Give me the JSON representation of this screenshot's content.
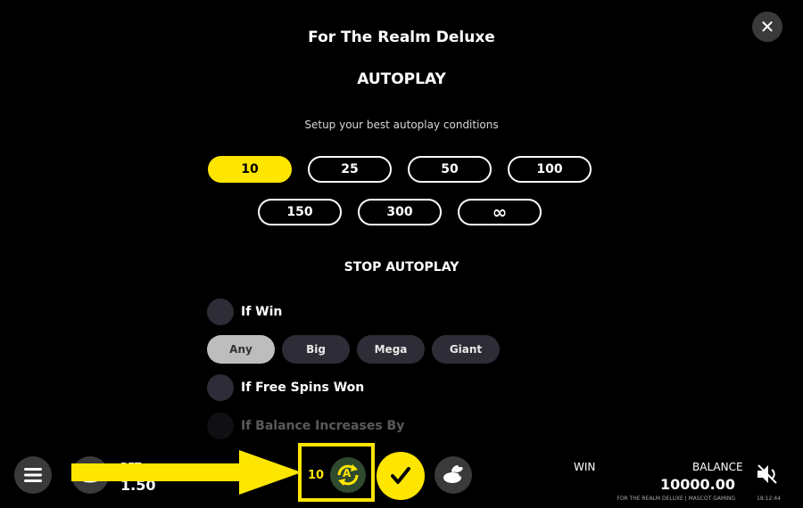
{
  "header": {
    "title": "For The Realm Deluxe",
    "close_glyph": "✕"
  },
  "autoplay": {
    "heading": "AUTOPLAY",
    "subtitle": "Setup your best autoplay conditions",
    "counts": [
      "10",
      "25",
      "50",
      "100",
      "150",
      "300",
      "∞"
    ],
    "selected_count": "10"
  },
  "stop": {
    "heading": "STOP AUTOPLAY",
    "if_win": "If Win",
    "win_options": [
      "Any",
      "Big",
      "Mega",
      "Giant"
    ],
    "selected_win_option": "Any",
    "if_free_spins": "If Free Spins Won",
    "if_balance": "If Balance Increases By"
  },
  "bottom_bar": {
    "bet_label": "BET",
    "bet_value": "1.50",
    "autoplay_count": "10",
    "autoplay_badge": "A",
    "win_label": "WIN",
    "balance_label": "BALANCE",
    "balance_value": "10000.00",
    "footer_text": "FOR THE REALM DELUXE | MASCOT GAMING",
    "clock": "18:12:44"
  },
  "colors": {
    "accent": "#ffe600",
    "chip": "#2e2c36",
    "chip_selected": "#bdbdbd",
    "annotation": "#ffe600"
  }
}
